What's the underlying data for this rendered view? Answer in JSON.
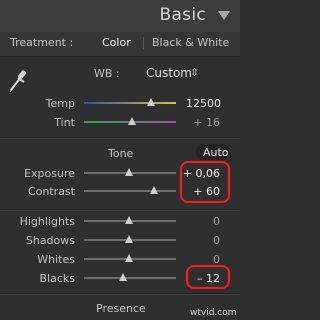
{
  "header": {
    "title": "Basic"
  },
  "treatment": {
    "label": "Treatment :",
    "color": "Color",
    "bw": "Black & White"
  },
  "wb": {
    "label": "WB :",
    "value": "Custom",
    "arrow": "⇕"
  },
  "temp": {
    "label": "Temp",
    "value": "12500",
    "level": 0.85
  },
  "tint": {
    "label": "Tint",
    "value": "+ 16",
    "level": 0.55
  },
  "tone": {
    "label": "Tone",
    "auto": "Auto"
  },
  "exposure": {
    "label": "Exposure",
    "value": "+ 0,06",
    "level": 0.5
  },
  "contrast": {
    "label": "Contrast",
    "value": "+ 60",
    "level": 0.8
  },
  "highlights": {
    "label": "Highlights",
    "value": "0",
    "level": 0.5
  },
  "shadows": {
    "label": "Shadows",
    "value": "0",
    "level": 0.5
  },
  "whites": {
    "label": "Whites",
    "value": "0",
    "level": 0.5
  },
  "blacks": {
    "label": "Blacks",
    "value": "– 12",
    "level": 0.44
  },
  "presence": {
    "label": "Presence"
  },
  "watermark": "wtvid.com",
  "colors": {
    "highlight": "#ff1a1a",
    "panel": "#2f2f2f"
  }
}
